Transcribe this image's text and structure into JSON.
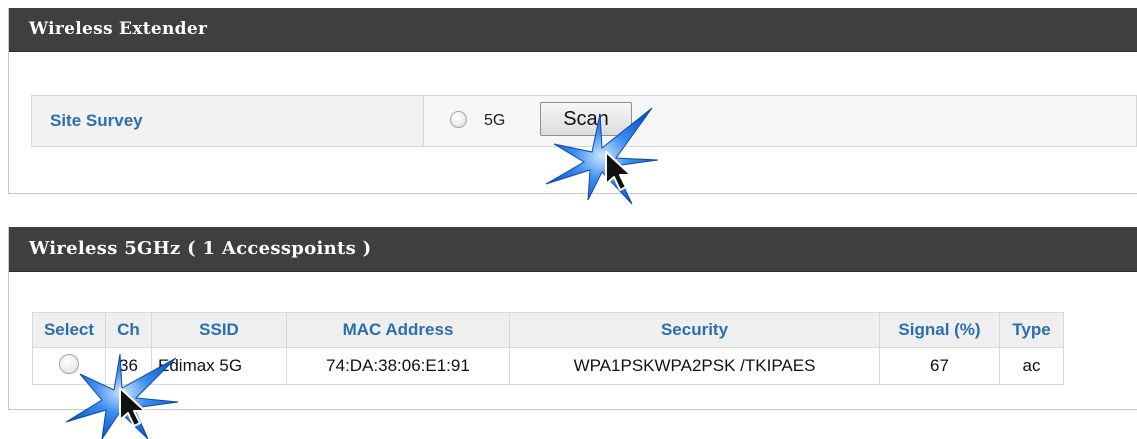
{
  "extender": {
    "header_title": "Wireless Extender",
    "site_survey_label": "Site Survey",
    "band_option": "5G",
    "scan_button": "Scan"
  },
  "results": {
    "header_prefix": "Wireless 5GHz",
    "header_count": "( 1 Accesspoints )",
    "columns": {
      "select": "Select",
      "ch": "Ch",
      "ssid": "SSID",
      "mac": "MAC Address",
      "security": "Security",
      "signal": "Signal (%)",
      "type": "Type"
    },
    "rows": [
      {
        "ch": "36",
        "ssid": "Edimax 5G",
        "mac": "74:DA:38:06:E1:91",
        "security": "WPA1PSKWPA2PSK /TKIPAES",
        "signal": "67",
        "type": "ac"
      }
    ]
  },
  "colors": {
    "header_bg": "#3e3f3f",
    "label_blue": "#2a6fb0",
    "burst_blue": "#1f6fd1"
  },
  "icons": [
    "radio-icon",
    "cursor-arrow-icon",
    "click-burst-icon"
  ]
}
